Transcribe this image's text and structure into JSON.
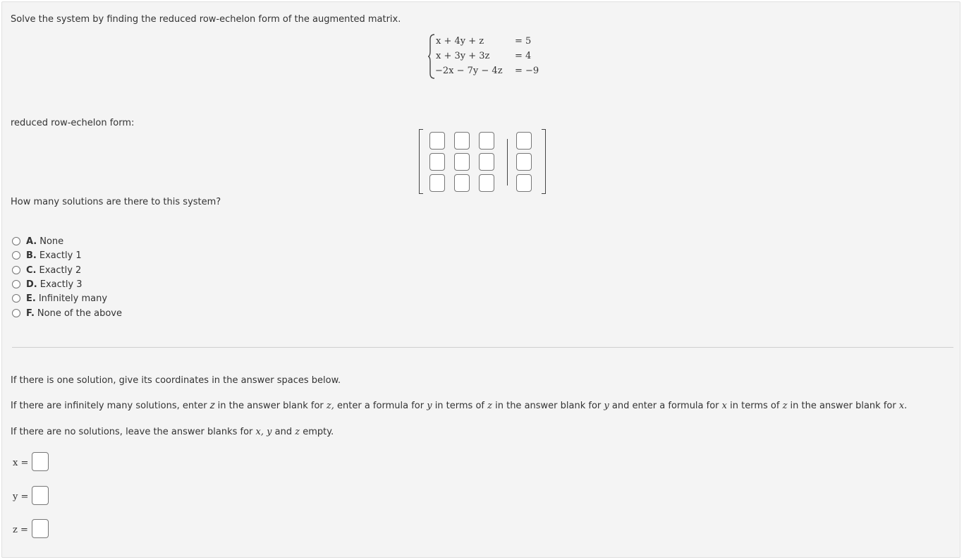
{
  "question": {
    "instruction": "Solve the system by finding the reduced row-echelon form of the augmented matrix.",
    "equations": [
      {
        "lhs": "x + 4y + z",
        "rhs": "= 5"
      },
      {
        "lhs": "x + 3y + 3z",
        "rhs": "= 4"
      },
      {
        "lhs": "−2x − 7y − 4z",
        "rhs": "= −9"
      }
    ],
    "rref_label": "reduced row-echelon form:",
    "count_prompt": "How many solutions are there to this system?"
  },
  "choices": [
    {
      "letter": "A.",
      "text": "None"
    },
    {
      "letter": "B.",
      "text": "Exactly 1"
    },
    {
      "letter": "C.",
      "text": "Exactly 2"
    },
    {
      "letter": "D.",
      "text": "Exactly 3"
    },
    {
      "letter": "E.",
      "text": "Infinitely many"
    },
    {
      "letter": "F.",
      "text": "None of the above"
    }
  ],
  "instructions2": {
    "one": "If there is one solution, give its coordinates in the answer spaces below.",
    "inf_a": "If there are infinitely many solutions, enter ",
    "inf_z1": "z",
    "inf_b": " in the answer blank for ",
    "inf_z2": "z,",
    "inf_c": " enter a formula for ",
    "inf_y1": "y",
    "inf_d": " in terms of ",
    "inf_z3": "z",
    "inf_e": " in the answer blank for ",
    "inf_y2": "y",
    "inf_f": " and enter a formula for ",
    "inf_x1": "x",
    "inf_g": " in terms of ",
    "inf_z4": "z",
    "inf_h": " in the answer blank for ",
    "inf_x2": "x.",
    "none_a": "If there are no solutions, leave the answer blanks for ",
    "none_x": "x,",
    "none_y": "y",
    "none_b": " and ",
    "none_z": "z",
    "none_c": " empty."
  },
  "answers": [
    {
      "label": "x ="
    },
    {
      "label": "y ="
    },
    {
      "label": "z ="
    }
  ]
}
